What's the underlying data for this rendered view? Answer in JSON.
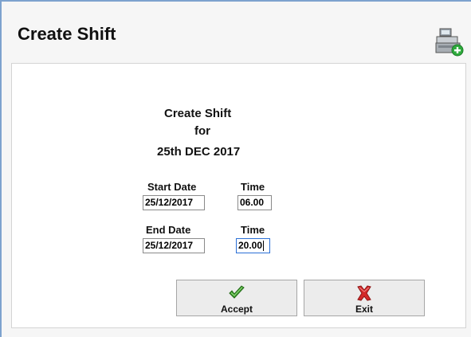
{
  "window": {
    "title": "Create Shift",
    "header_icon": "cash-register-add-icon"
  },
  "form": {
    "heading_line1": "Create Shift",
    "heading_line2": "for",
    "heading_line3": "25th DEC 2017",
    "start_date_label": "Start Date",
    "start_date_value": "25/12/2017",
    "start_time_label": "Time",
    "start_time_value": "06.00",
    "end_date_label": "End Date",
    "end_date_value": "25/12/2017",
    "end_time_label": "Time",
    "end_time_value": "20.00"
  },
  "buttons": {
    "accept_label": "Accept",
    "accept_icon": "green-checkmark-icon",
    "exit_label": "Exit",
    "exit_icon": "red-x-icon"
  },
  "colors": {
    "accept_icon": "#3a9a2a",
    "exit_icon": "#d42a2a",
    "window_border": "#7da2ce"
  }
}
